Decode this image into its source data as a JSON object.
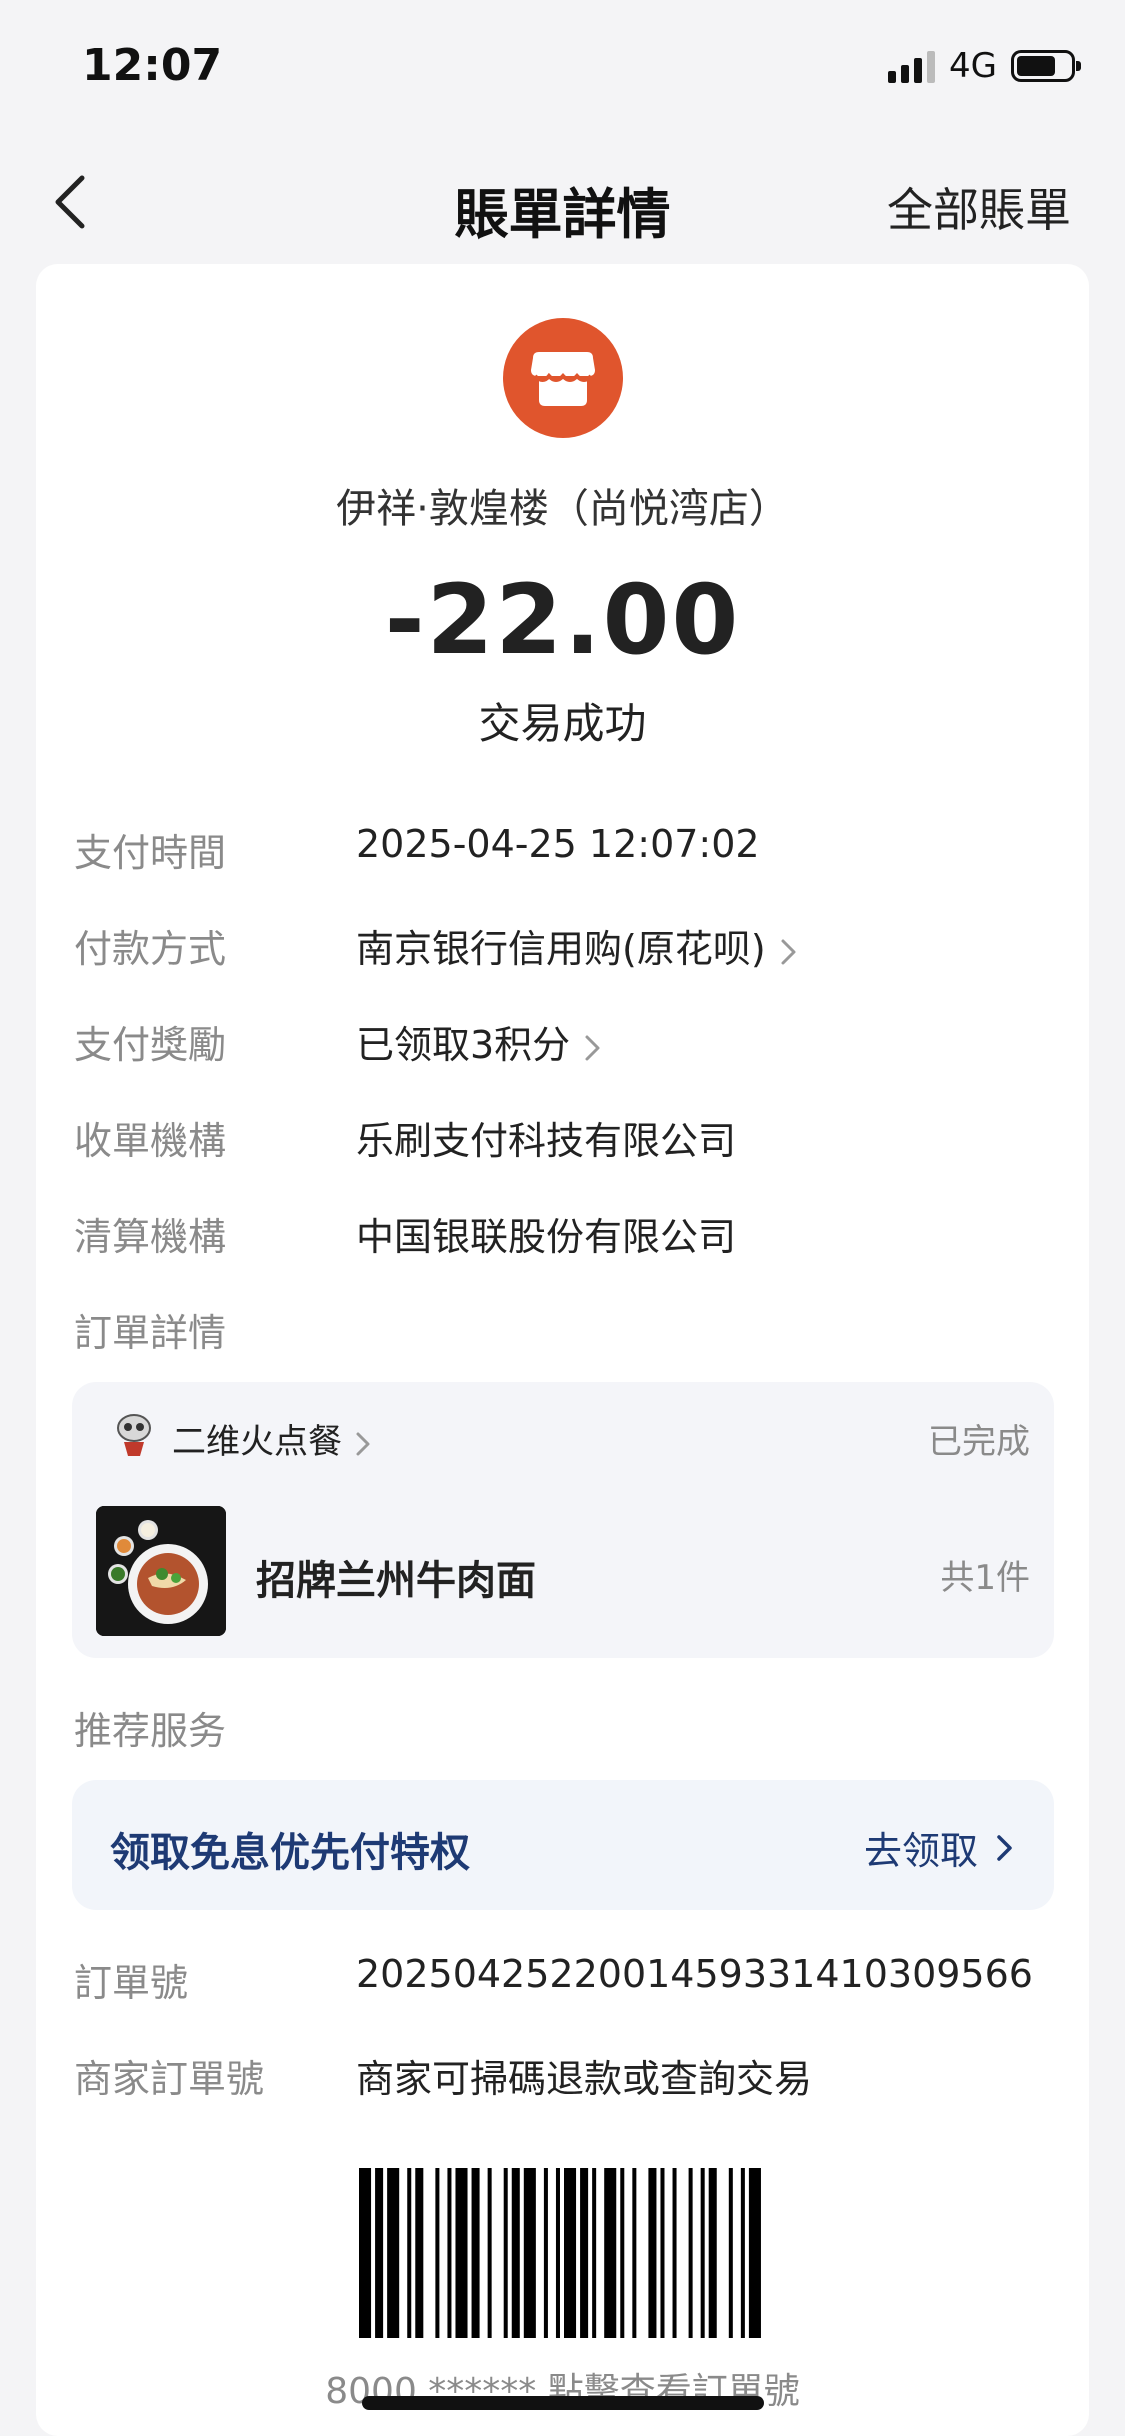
{
  "status_bar": {
    "time": "12:07",
    "network": "4G"
  },
  "nav": {
    "title": "賬單詳情",
    "right_link": "全部賬單"
  },
  "merchant": {
    "name": "伊祥·敦煌楼（尚悦湾店）",
    "icon": "storefront-icon",
    "icon_color": "#e0552d"
  },
  "transaction": {
    "amount": "-22.00",
    "status": "交易成功"
  },
  "details": [
    {
      "label": "支付時間",
      "value": "2025-04-25 12:07:02"
    },
    {
      "label": "付款方式",
      "value": "南京银行信用购(原花呗)"
    },
    {
      "label": "支付獎勵",
      "value": "已领取3积分"
    },
    {
      "label": "收單機構",
      "value": "乐刷支付科技有限公司"
    },
    {
      "label": "清算機構",
      "value": "中国银联股份有限公司"
    }
  ],
  "order_section": {
    "label": "訂單詳情",
    "shop_name": "二维火点餐",
    "status": "已完成",
    "item_name": "招牌兰州牛肉面",
    "item_count": "共1件"
  },
  "recommend": {
    "label": "推荐服务",
    "promo_text": "领取免息优先付特权",
    "action_label": "去领取",
    "accent_color": "#1e3a74"
  },
  "order_numbers": [
    {
      "label": "訂單號",
      "value": "2025042522001459331410309566"
    },
    {
      "label": "商家訂單號",
      "value": "商家可掃碼退款或查詢交易"
    }
  ],
  "barcode": {
    "caption": "8000 ****** 點擊查看訂單號"
  }
}
